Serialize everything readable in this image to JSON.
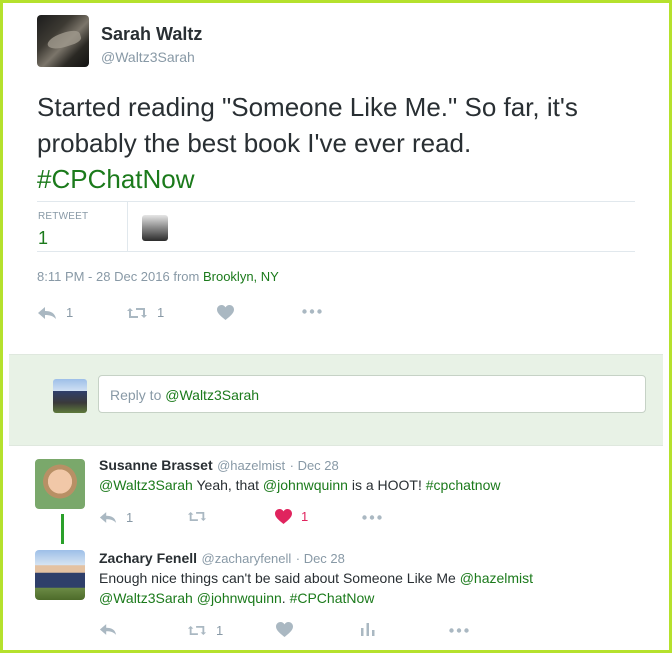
{
  "tweet": {
    "author_name": "Sarah Waltz",
    "author_handle": "@Waltz3Sarah",
    "text_plain": "Started reading \"Someone Like Me.\" So far, it's probably the best book I've ever read.",
    "hashtag": "#CPChatNow",
    "retweet_label": "RETWEET",
    "retweet_count": "1",
    "timestamp": "8:11 PM - 28 Dec 2016 from",
    "location": "Brooklyn, NY",
    "actions": {
      "reply_count": "1",
      "retweet_count": "1"
    }
  },
  "reply_box": {
    "prefix": "Reply to",
    "mention": "@Waltz3Sarah"
  },
  "replies": [
    {
      "name": "Susanne Brasset",
      "handle": "@hazelmist",
      "date": "· Dec 28",
      "mention1": "@Waltz3Sarah",
      "text1": " Yeah, that ",
      "mention2": "@johnwquinn",
      "text2": " is a HOOT! ",
      "hashtag": "#cpchatnow",
      "reply_count": "1",
      "like_count": "1"
    },
    {
      "name": "Zachary Fenell",
      "handle": "@zacharyfenell",
      "date": "· Dec 28",
      "text1": "Enough nice things can't be said about Someone Like Me ",
      "mention1": "@hazelmist",
      "mention2": "@Waltz3Sarah",
      "mention3": "@johnwquinn",
      "hashtag": "#CPChatNow",
      "retweet_count": "1"
    }
  ],
  "colors": {
    "accent": "#1b7a1b",
    "frame": "#b5e12d",
    "like": "#e0245e",
    "muted": "#8899a6"
  }
}
